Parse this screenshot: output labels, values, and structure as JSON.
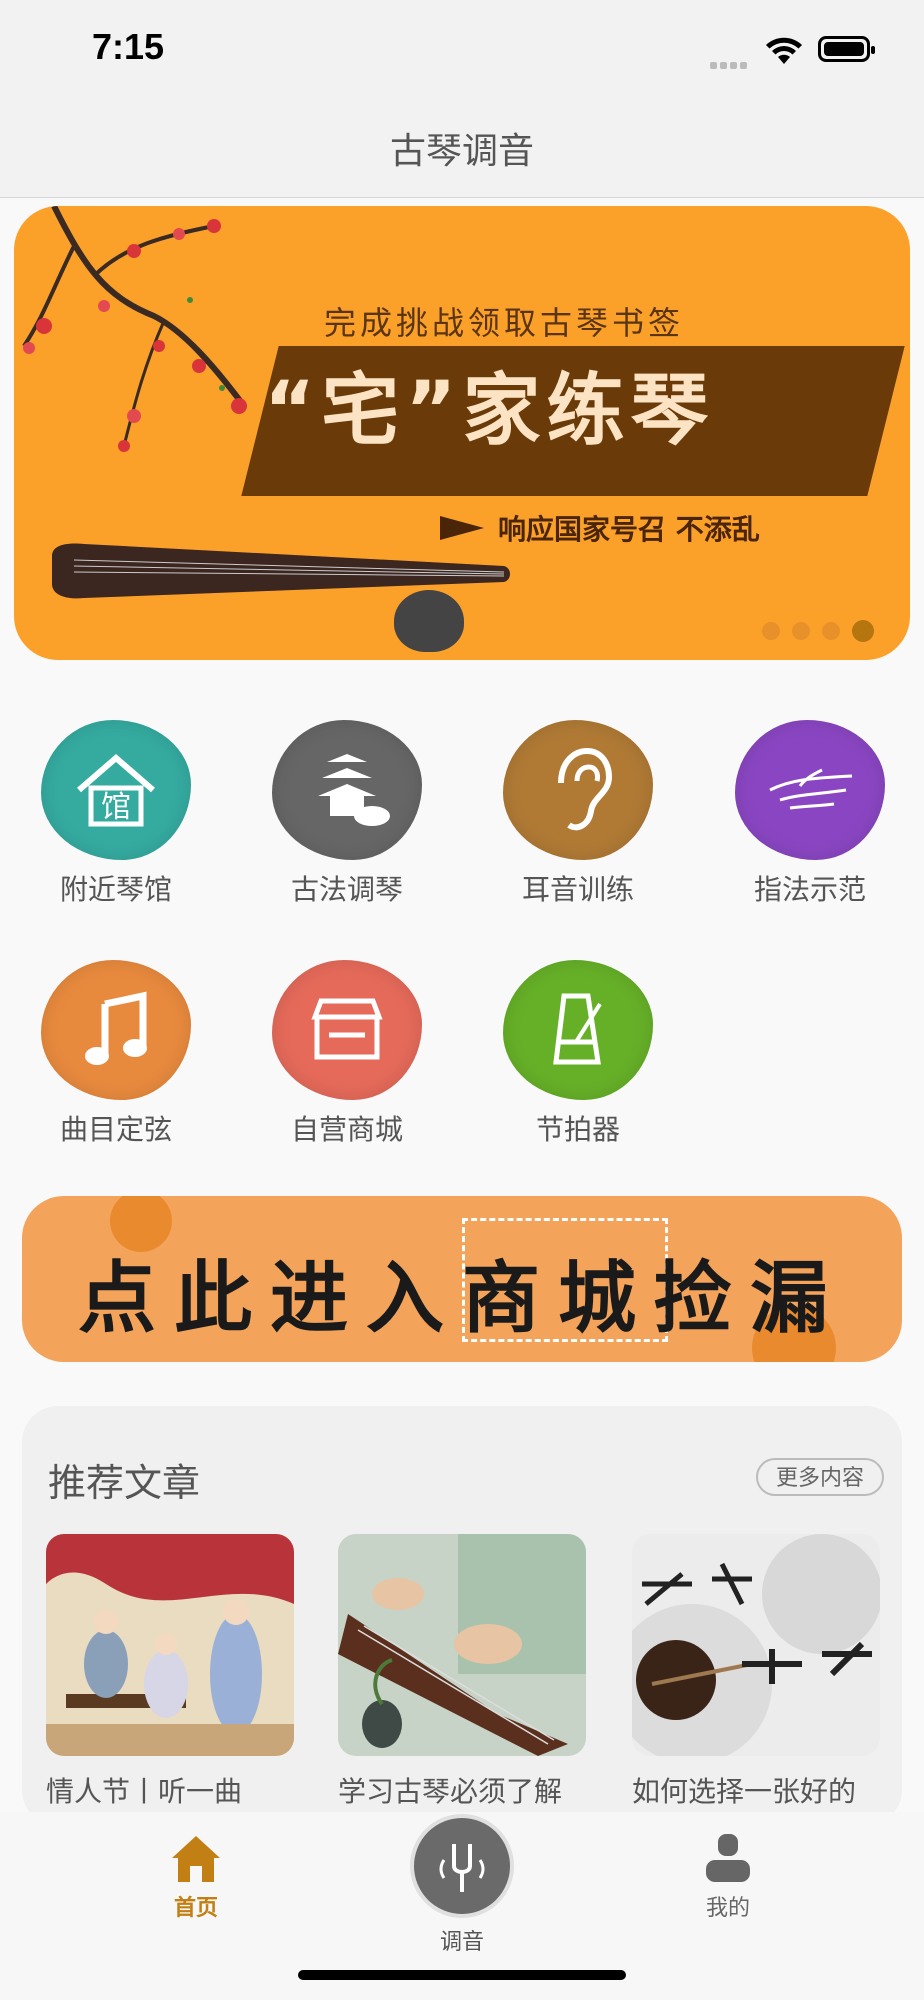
{
  "status": {
    "time": "7:15"
  },
  "nav": {
    "title": "古琴调音"
  },
  "banner": {
    "subtitle": "完成挑战领取古琴书签",
    "headline": "“宅”家练琴",
    "tagline": "响应国家号召 不添乱",
    "page_count": 4,
    "active_index": 3,
    "bg_color": "#fba12a"
  },
  "grid": {
    "items": [
      {
        "label": "附近琴馆",
        "icon": "guqin-hall-icon",
        "color": "#35aba0"
      },
      {
        "label": "古法调琴",
        "icon": "pagoda-icon",
        "color": "#666666"
      },
      {
        "label": "耳音训练",
        "icon": "ear-icon",
        "color": "#b07a35"
      },
      {
        "label": "指法示范",
        "icon": "hand-icon",
        "color": "#8a46c2"
      },
      {
        "label": "曲目定弦",
        "icon": "music-note-icon",
        "color": "#e88a3e"
      },
      {
        "label": "自营商城",
        "icon": "store-icon",
        "color": "#e56a5a"
      },
      {
        "label": "节拍器",
        "icon": "metronome-icon",
        "color": "#66b028"
      }
    ]
  },
  "mall": {
    "text": "点此进入商城捡漏"
  },
  "articles": {
    "title": "推荐文章",
    "more": "更多内容",
    "items": [
      {
        "title": "情人节丨听一曲"
      },
      {
        "title": "学习古琴必须了解"
      },
      {
        "title": "如何选择一张好的"
      }
    ]
  },
  "tabs": {
    "home": "首页",
    "tune": "调音",
    "mine": "我的",
    "active_color": "#c27f13"
  }
}
